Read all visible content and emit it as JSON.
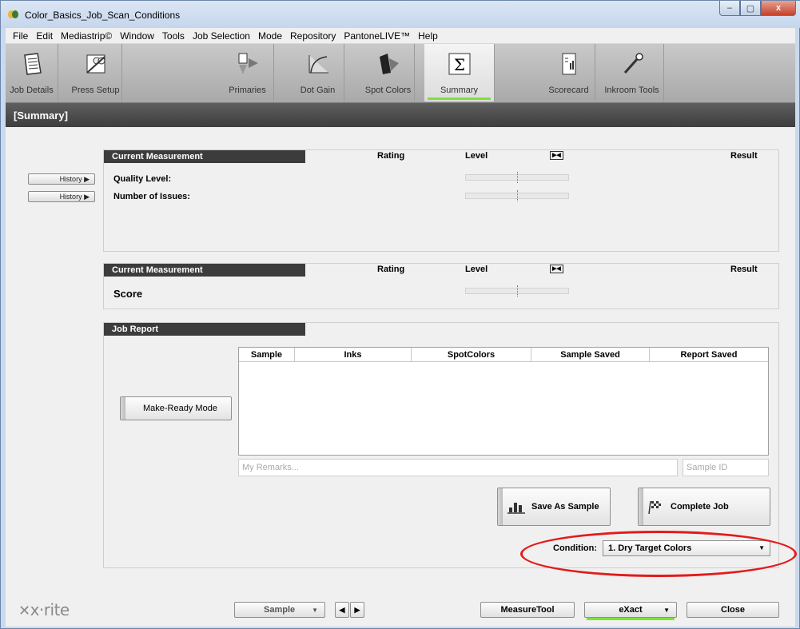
{
  "window": {
    "title": "Color_Basics_Job_Scan_Conditions",
    "controls": [
      "–",
      "▢",
      "x"
    ]
  },
  "menu": [
    "File",
    "Edit",
    "Mediastrip©",
    "Window",
    "Tools",
    "Job Selection",
    "Mode",
    "Repository",
    "PantoneLIVE™",
    "Help"
  ],
  "toolbar": {
    "job_details": "Job Details",
    "press_setup": "Press Setup",
    "primaries": "Primaries",
    "dot_gain": "Dot Gain",
    "spot_colors": "Spot Colors",
    "summary": "Summary",
    "scorecard": "Scorecard",
    "inkroom_tools": "Inkroom Tools"
  },
  "section_title": "[Summary]",
  "panel1": {
    "header": {
      "current": "Current Measurement",
      "rating": "Rating",
      "level": "Level",
      "result": "Result"
    },
    "history_label": "History ▶",
    "quality_level": "Quality Level:",
    "number_of_issues": "Number of Issues:"
  },
  "panel2": {
    "header": {
      "current": "Current Measurement",
      "rating": "Rating",
      "level": "Level",
      "result": "Result"
    },
    "score": "Score"
  },
  "job_report": {
    "title": "Job Report",
    "make_ready": "Make-Ready Mode",
    "columns": [
      "Sample",
      "Inks",
      "SpotColors",
      "Sample Saved",
      "Report Saved"
    ],
    "remarks_placeholder": "My Remarks...",
    "sample_id_placeholder": "Sample ID",
    "save_as_sample": "Save As Sample",
    "complete_job": "Complete Job",
    "condition_label": "Condition:",
    "condition_value": "1. Dry Target Colors"
  },
  "footer": {
    "logo": "x·rite",
    "sample": "Sample",
    "measure_tool": "MeasureTool",
    "exact": "eXact",
    "close": "Close"
  },
  "colors": {
    "accent_green": "#7fe03c",
    "highlight_red": "#e31b1b"
  }
}
